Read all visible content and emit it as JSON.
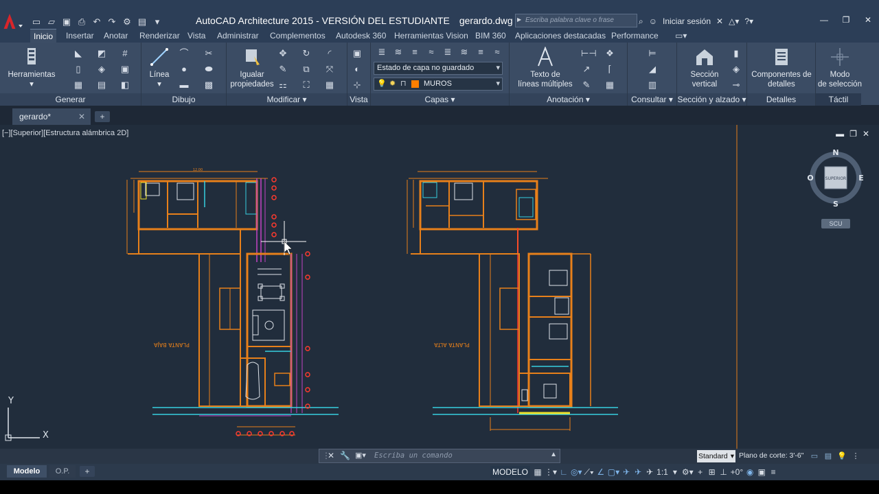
{
  "title_bar": {
    "app_title": "AutoCAD Architecture 2015 - VERSIÓN DEL ESTUDIANTE",
    "file_name": "gerardo.dwg",
    "search_placeholder": "Escriba palabra clave o frase",
    "sign_in": "Iniciar sesión"
  },
  "ribbon_tabs": [
    "Inicio",
    "Insertar",
    "Anotar",
    "Renderizar",
    "Vista",
    "Administrar",
    "Complementos",
    "Autodesk 360",
    "Herramientas Vision",
    "BIM 360",
    "Aplicaciones destacadas",
    "Performance"
  ],
  "ribbon": {
    "generar": {
      "title": "Generar",
      "herramientas": "Herramientas"
    },
    "dibujo": {
      "title": "Dibujo",
      "linea": "Línea"
    },
    "modificar": {
      "title": "Modificar",
      "igualar_line1": "Igualar",
      "igualar_line2": "propiedades"
    },
    "vista": {
      "title": "Vista"
    },
    "capas": {
      "title": "Capas",
      "layer_state": "Estado de capa no guardado",
      "current_layer": "MUROS",
      "layer_color": "#ff7f00"
    },
    "anotacion": {
      "title": "Anotación",
      "texto_line1": "Texto de",
      "texto_line2": "líneas múltiples"
    },
    "consultar": {
      "title": "Consultar"
    },
    "seccion": {
      "title": "Sección y alzado",
      "btn_line1": "Sección",
      "btn_line2": "vertical"
    },
    "detalles": {
      "title": "Detalles",
      "btn_line1": "Componentes de",
      "btn_line2": "detalles"
    },
    "tactil": {
      "title": "Táctil",
      "btn_line1": "Modo",
      "btn_line2": "de selección"
    }
  },
  "file_tab": {
    "name": "gerardo*"
  },
  "viewport": {
    "label": "[−][Superior][Estructura alámbrica 2D]",
    "compass": {
      "n": "N",
      "s": "S",
      "e": "E",
      "o": "O",
      "face": "SUPERIOR",
      "ucs": "SCU"
    },
    "ucs_x": "X",
    "ucs_y": "Y",
    "plan_labels": [
      "PLANTA BAJA",
      "PLANTA ALTA"
    ]
  },
  "command_line": {
    "placeholder": "Escriba un comando"
  },
  "annotation_scale": "Standard",
  "cut_plane": "Plano de corte: 3'-6\"",
  "status": {
    "model_tab": "Modelo",
    "layout_tab": "O.P.",
    "model_button": "MODELO",
    "scale": "1:1",
    "angle": "+0°"
  },
  "colors": {
    "walls": "#e8801a",
    "accent_red": "#ff3a2e",
    "cyan": "#37d0e0",
    "magenta": "#c444c4",
    "yellow": "#f0e22a",
    "canvas_bg": "#212d3c"
  }
}
